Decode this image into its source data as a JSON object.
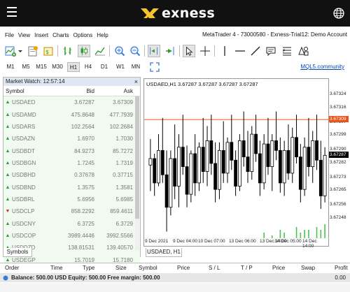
{
  "header": {
    "brand": "exness"
  },
  "menubar": {
    "items": [
      "File",
      "View",
      "Insert",
      "Charts",
      "Options",
      "Help"
    ],
    "title": "MetaTrader 4 - 73000580 - Exness-Trial12: Demo Account"
  },
  "toolbar": {
    "icons": [
      "new-chart-icon",
      "profiles-icon",
      "market-watch-icon",
      "navigator-icon",
      "bar-chart-icon",
      "candlestick-icon",
      "line-chart-icon",
      "zoom-in-icon",
      "zoom-out-icon",
      "chart-shift-icon",
      "auto-scroll-icon",
      "cursor-icon",
      "crosshair-icon",
      "vertical-line-icon",
      "horizontal-line-icon",
      "trendline-icon",
      "text-icon",
      "fibonacci-icon",
      "shapes-icon"
    ],
    "timeframes": [
      "M1",
      "M5",
      "M15",
      "M30",
      "H1",
      "H4",
      "D1",
      "W1",
      "MN"
    ],
    "active_timeframe": "H1",
    "mql_link": "MQL5.community"
  },
  "market_watch": {
    "title": "Market Watch: 12:57:14",
    "headers": {
      "symbol": "Symbol",
      "bid": "Bid",
      "ask": "Ask"
    },
    "rows": [
      {
        "symbol": "USDAED",
        "bid": "3.67287",
        "ask": "3.67309",
        "dir": "up"
      },
      {
        "symbol": "USDAMD",
        "bid": "475.8648",
        "ask": "477.7939",
        "dir": "up"
      },
      {
        "symbol": "USDARS",
        "bid": "102.2564",
        "ask": "102.2684",
        "dir": "up"
      },
      {
        "symbol": "USDAZN",
        "bid": "1.6970",
        "ask": "1.7030",
        "dir": "up"
      },
      {
        "symbol": "USDBDT",
        "bid": "84.9273",
        "ask": "85.7272",
        "dir": "up"
      },
      {
        "symbol": "USDBGN",
        "bid": "1.7245",
        "ask": "1.7319",
        "dir": "up"
      },
      {
        "symbol": "USDBHD",
        "bid": "0.37678",
        "ask": "0.37715",
        "dir": "up"
      },
      {
        "symbol": "USDBND",
        "bid": "1.3575",
        "ask": "1.3581",
        "dir": "up"
      },
      {
        "symbol": "USDBRL",
        "bid": "5.6956",
        "ask": "5.6985",
        "dir": "up"
      },
      {
        "symbol": "USDCLP",
        "bid": "858.2292",
        "ask": "859.4611",
        "dir": "down"
      },
      {
        "symbol": "USDCNY",
        "bid": "6.3725",
        "ask": "6.3729",
        "dir": "up"
      },
      {
        "symbol": "USDCOP",
        "bid": "3989.4446",
        "ask": "3992.5566",
        "dir": "up"
      },
      {
        "symbol": "USDDZD",
        "bid": "138.81531",
        "ask": "139.40570",
        "dir": "up"
      },
      {
        "symbol": "USDEGP",
        "bid": "15.7019",
        "ask": "15.7180",
        "dir": "up"
      }
    ],
    "tab": "Symbols"
  },
  "chart": {
    "header": "USDAED,H1  3.67287 3.67287 3.67287 3.67287",
    "tab": "USDAED, H1",
    "price_ticks": [
      "3.67324",
      "3.67316",
      "3.67307",
      "3.67299",
      "3.67290",
      "3.67282",
      "3.67273",
      "3.67265",
      "3.67256",
      "3.67248"
    ],
    "ask_tag": "3.67309",
    "bid_tag": "3.67287",
    "ask_color": "#e8541c",
    "bid_color": "#000000",
    "time_ticks": [
      "9 Dec 2021",
      "9 Dec 04:00",
      "10 Dec 07:00",
      "13 Dec 06:00",
      "13 Dec 14:00",
      "14 Dec 05:00",
      "14 Dec 14:00"
    ]
  },
  "chart_data": {
    "type": "candlestick",
    "symbol": "USDAED",
    "timeframe": "H1",
    "ylim": [
      3.67248,
      3.67328
    ],
    "ask_line": 3.67309,
    "bid": 3.67287,
    "candles": [
      [
        3.67281,
        3.67297,
        3.67265,
        3.67285
      ],
      [
        3.67285,
        3.67288,
        3.67262,
        3.6727
      ],
      [
        3.6727,
        3.673,
        3.67268,
        3.6729
      ],
      [
        3.6729,
        3.6731,
        3.6727,
        3.67275
      ],
      [
        3.67275,
        3.6729,
        3.6724,
        3.67255
      ],
      [
        3.67255,
        3.6729,
        3.6725,
        3.67285
      ],
      [
        3.67285,
        3.67306,
        3.6726,
        3.67268
      ],
      [
        3.67268,
        3.673,
        3.67255,
        3.67292
      ],
      [
        3.67292,
        3.67312,
        3.67275,
        3.6728
      ],
      [
        3.6728,
        3.67293,
        3.67255,
        3.67263
      ],
      [
        3.67263,
        3.6729,
        3.67258,
        3.67288
      ],
      [
        3.67288,
        3.673,
        3.67262,
        3.6727
      ],
      [
        3.6727,
        3.67295,
        3.67265,
        3.67292
      ],
      [
        3.67292,
        3.6731,
        3.6727,
        3.67277
      ],
      [
        3.67277,
        3.67305,
        3.67268,
        3.67296
      ],
      [
        3.67296,
        3.67312,
        3.67275,
        3.67282
      ],
      [
        3.67282,
        3.67295,
        3.67258,
        3.67266
      ],
      [
        3.67266,
        3.67295,
        3.6726,
        3.6729
      ],
      [
        3.6729,
        3.67308,
        3.6727,
        3.67276
      ],
      [
        3.67276,
        3.67298,
        3.6727,
        3.67295
      ],
      [
        3.67295,
        3.67312,
        3.67278,
        3.67284
      ],
      [
        3.67284,
        3.6729,
        3.67262,
        3.67268
      ],
      [
        3.67268,
        3.673,
        3.67265,
        3.67296
      ],
      [
        3.67296,
        3.67314,
        3.6728,
        3.67286
      ],
      [
        3.67286,
        3.67302,
        3.6727,
        3.67277
      ],
      [
        3.67277,
        3.67305,
        3.67272,
        3.673
      ],
      [
        3.673,
        3.67312,
        3.67283,
        3.67288
      ],
      [
        3.67288,
        3.67296,
        3.67262,
        3.6727
      ],
      [
        3.6727,
        3.673,
        3.67266,
        3.67294
      ],
      [
        3.67294,
        3.6731,
        3.67275,
        3.6728
      ],
      [
        3.6728,
        3.673,
        3.67265,
        3.67296
      ],
      [
        3.67296,
        3.67314,
        3.67284,
        3.6729
      ],
      [
        3.6729,
        3.67298,
        3.67264,
        3.6727
      ],
      [
        3.6727,
        3.67296,
        3.67262,
        3.6729
      ],
      [
        3.6729,
        3.67306,
        3.67272,
        3.67276
      ],
      [
        3.67276,
        3.67304,
        3.6727,
        3.67298
      ],
      [
        3.67298,
        3.67312,
        3.67282,
        3.67286
      ],
      [
        3.67286,
        3.67294,
        3.67258,
        3.67266
      ],
      [
        3.67266,
        3.67298,
        3.67262,
        3.67292
      ],
      [
        3.67292,
        3.6731,
        3.67274,
        3.6728
      ],
      [
        3.6728,
        3.67302,
        3.6727,
        3.67296
      ],
      [
        3.67296,
        3.67312,
        3.67278,
        3.67284
      ],
      [
        3.67284,
        3.67296,
        3.67254,
        3.67262
      ],
      [
        3.67262,
        3.67292,
        3.67258,
        3.67287
      ]
    ],
    "volume": [
      0,
      0,
      0,
      0,
      0,
      0,
      0,
      0,
      0,
      0,
      0,
      0,
      0,
      0,
      0,
      0,
      0,
      0,
      0,
      0,
      0,
      0,
      0,
      0,
      0,
      0,
      0,
      0,
      2,
      0,
      1,
      0,
      3,
      2,
      0,
      0,
      4,
      2,
      3,
      3,
      0,
      4,
      3,
      5
    ]
  },
  "terminal": {
    "headers": [
      "Order",
      "Time",
      "Type",
      "Size",
      "Symbol",
      "Price",
      "S / L",
      "T / P",
      "Price",
      "Swap",
      "Profit"
    ],
    "balance_line": "Balance: 500.00 USD  Equity: 500.00  Free margin: 500.00",
    "profit_value": "0.00"
  }
}
